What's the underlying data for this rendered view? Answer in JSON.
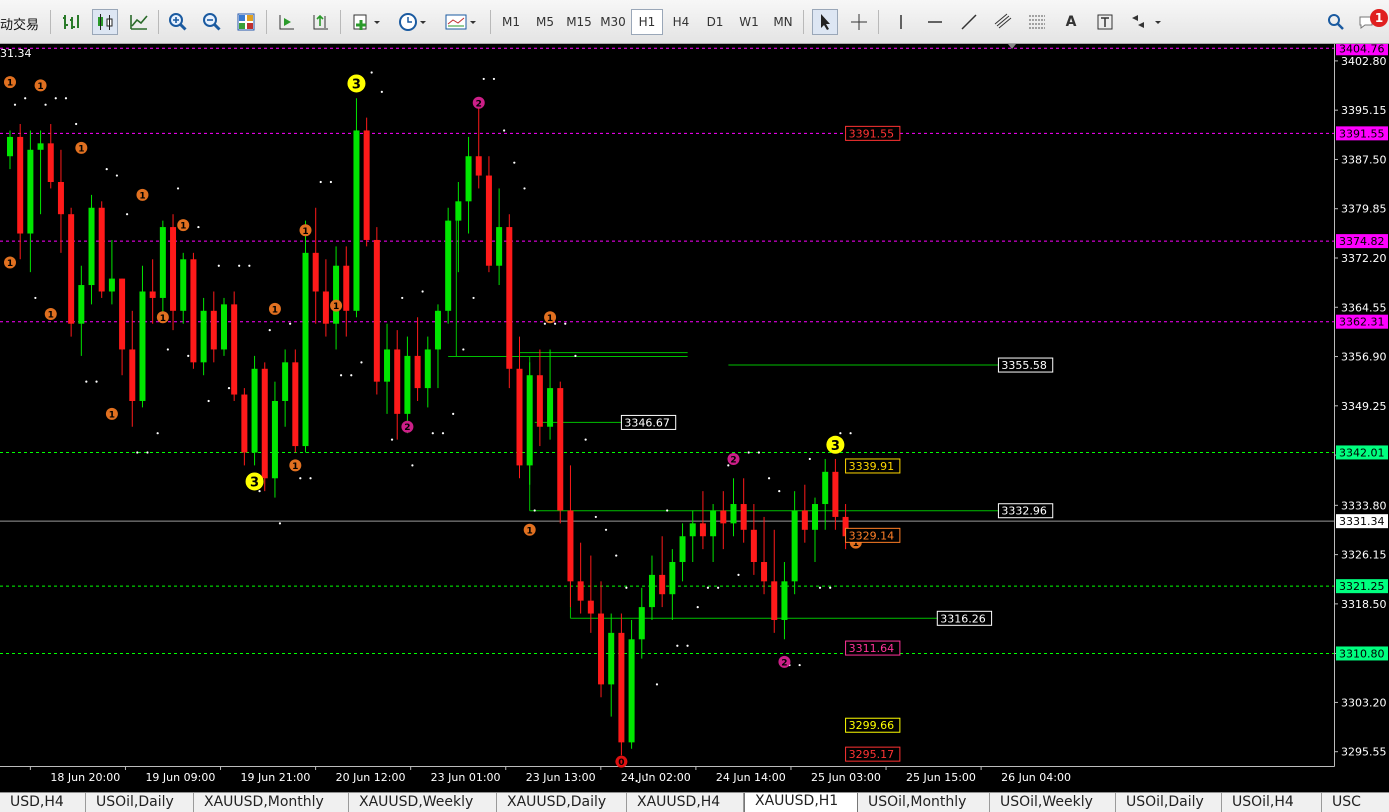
{
  "toolbar": {
    "app_title": "动交易",
    "timeframes": [
      "M1",
      "M5",
      "M15",
      "M30",
      "H1",
      "H4",
      "D1",
      "W1",
      "MN"
    ],
    "active_timeframe": "H1",
    "notification_count": "1"
  },
  "chart": {
    "symbol": "XAUUSD",
    "timeframe": "H1",
    "top_left_price": "31.34",
    "current_price": "3331.34",
    "price_axis": [
      "3402.80",
      "3395.15",
      "3387.50",
      "3379.85",
      "3372.20",
      "3364.55",
      "3356.90",
      "3349.25",
      "3341.60",
      "3333.80",
      "3326.15",
      "3318.50",
      "3310.80",
      "3303.20",
      "3295.55"
    ],
    "time_axis": [
      "18 Jun 20:00",
      "19 Jun 09:00",
      "19 Jun 21:00",
      "20 Jun 12:00",
      "23 Jun 01:00",
      "23 Jun 13:00",
      "24 Jun 02:00",
      "24 Jun 14:00",
      "25 Jun 03:00",
      "25 Jun 15:00",
      "26 Jun 04:00"
    ],
    "axis_labels": [
      {
        "text": "3404.76",
        "price": 3404.76,
        "bg": "#ff00ff",
        "fg": "#000000"
      },
      {
        "text": "3391.55",
        "price": 3391.55,
        "bg": "#ff00ff",
        "fg": "#000000"
      },
      {
        "text": "3374.82",
        "price": 3374.82,
        "bg": "#ff00ff",
        "fg": "#000000"
      },
      {
        "text": "3362.31",
        "price": 3362.31,
        "bg": "#ff00ff",
        "fg": "#000000"
      },
      {
        "text": "3342.01",
        "price": 3342.01,
        "bg": "#00ff7f",
        "fg": "#000000"
      },
      {
        "text": "3331.34",
        "price": 3331.34,
        "bg": "#ffffff",
        "fg": "#000000"
      },
      {
        "text": "3321.25",
        "price": 3321.25,
        "bg": "#00ff7f",
        "fg": "#000000"
      },
      {
        "text": "3310.80",
        "price": 3310.8,
        "bg": "#00ff7f",
        "fg": "#000000"
      }
    ],
    "level_lines": [
      {
        "price": 3404.76,
        "color": "#ff00ff"
      },
      {
        "price": 3391.55,
        "color": "#ff00ff"
      },
      {
        "price": 3374.82,
        "color": "#ff00ff"
      },
      {
        "price": 3362.31,
        "color": "#ff00ff"
      },
      {
        "price": 3342.01,
        "color": "#00ff00"
      },
      {
        "price": 3321.25,
        "color": "#00ff00"
      },
      {
        "price": 3310.8,
        "color": "#00ff00"
      }
    ],
    "inline_labels": [
      {
        "text": "3391.55",
        "price": 3391.55,
        "bar": 82,
        "color": "#ff3333",
        "border": "#ff3333",
        "bg": "#000000"
      },
      {
        "text": "3355.58",
        "price": 3355.58,
        "bar": 97,
        "color": "#ffffff",
        "border": "#ffffff",
        "bg": "#000000"
      },
      {
        "text": "3346.67",
        "price": 3346.67,
        "bar": 60,
        "color": "#ffffff",
        "border": "#ffffff",
        "bg": "#000000"
      },
      {
        "text": "3339.91",
        "price": 3339.91,
        "bar": 82,
        "color": "#ffd700",
        "border": "#ffd700",
        "bg": "#000000"
      },
      {
        "text": "3332.96",
        "price": 3332.96,
        "bar": 97,
        "color": "#ffffff",
        "border": "#ffffff",
        "bg": "#000000"
      },
      {
        "text": "3329.14",
        "price": 3329.14,
        "bar": 82,
        "color": "#ff7f27",
        "border": "#ff7f27",
        "bg": "#000000"
      },
      {
        "text": "3316.26",
        "price": 3316.26,
        "bar": 91,
        "color": "#ffffff",
        "border": "#ffffff",
        "bg": "#000000"
      },
      {
        "text": "3311.64",
        "price": 3311.64,
        "bar": 82,
        "color": "#ff3399",
        "border": "#ff3399",
        "bg": "#000000"
      },
      {
        "text": "3299.66",
        "price": 3299.66,
        "bar": 82,
        "color": "#ffff00",
        "border": "#ffff00",
        "bg": "#000000"
      },
      {
        "text": "3295.17",
        "price": 3295.17,
        "bar": 82,
        "color": "#ff3333",
        "border": "#ff3333",
        "bg": "#000000"
      }
    ],
    "markers": [
      {
        "t": "1",
        "bar": 0,
        "price": 3399.5,
        "c": "#e07020"
      },
      {
        "t": "1",
        "bar": 3,
        "price": 3399.0,
        "c": "#e07020"
      },
      {
        "t": "1",
        "bar": 0,
        "price": 3371.5,
        "c": "#e07020"
      },
      {
        "t": "1",
        "bar": 4,
        "price": 3363.5,
        "c": "#e07020"
      },
      {
        "t": "1",
        "bar": 7,
        "price": 3389.3,
        "c": "#e07020"
      },
      {
        "t": "1",
        "bar": 10,
        "price": 3348.0,
        "c": "#e07020"
      },
      {
        "t": "1",
        "bar": 13,
        "price": 3382.0,
        "c": "#e07020"
      },
      {
        "t": "1",
        "bar": 15,
        "price": 3363.0,
        "c": "#e07020"
      },
      {
        "t": "1",
        "bar": 17,
        "price": 3377.3,
        "c": "#e07020"
      },
      {
        "t": "3",
        "bar": 24,
        "price": 3337.5,
        "c": "#ffff00",
        "big": true
      },
      {
        "t": "1",
        "bar": 26,
        "price": 3364.3,
        "c": "#e07020"
      },
      {
        "t": "1",
        "bar": 29,
        "price": 3376.5,
        "c": "#e07020"
      },
      {
        "t": "1",
        "bar": 28,
        "price": 3340.0,
        "c": "#e07020"
      },
      {
        "t": "1",
        "bar": 32,
        "price": 3364.8,
        "c": "#e07020"
      },
      {
        "t": "3",
        "bar": 34,
        "price": 3399.3,
        "c": "#ffff00",
        "big": true
      },
      {
        "t": "2",
        "bar": 39,
        "price": 3346.0,
        "c": "#cc1f88"
      },
      {
        "t": "2",
        "bar": 46,
        "price": 3396.3,
        "c": "#cc1f88"
      },
      {
        "t": "1",
        "bar": 53,
        "price": 3363.0,
        "c": "#e07020"
      },
      {
        "t": "1",
        "bar": 51,
        "price": 3330.0,
        "c": "#e07020"
      },
      {
        "t": "2",
        "bar": 71,
        "price": 3341.0,
        "c": "#cc1f88"
      },
      {
        "t": "2",
        "bar": 76,
        "price": 3309.5,
        "c": "#cc1f88"
      },
      {
        "t": "3",
        "bar": 81,
        "price": 3343.2,
        "c": "#ffff00",
        "big": true
      },
      {
        "t": "1",
        "bar": 83,
        "price": 3328.0,
        "c": "#e07020"
      },
      {
        "t": "0",
        "bar": 60,
        "price": 3294.0,
        "c": "#e01010"
      }
    ],
    "hlines": [
      {
        "price": 3356.9,
        "bar_from": 43,
        "bar_to": 66.5,
        "color": "#00c000"
      },
      {
        "price": 3357.5,
        "bar_from": 50,
        "bar_to": 66.5,
        "color": "#00c000"
      },
      {
        "price": 3355.58,
        "bar_from": 70.5,
        "bar_to": 97,
        "color": "#00c000"
      },
      {
        "price": 3346.67,
        "bar_from": 51.5,
        "bar_to": 60,
        "color": "#00c000"
      },
      {
        "price": 3332.96,
        "bar_from": 51,
        "bar_to": 97,
        "color": "#00c000"
      },
      {
        "price": 3316.26,
        "bar_from": 55,
        "bar_to": 91,
        "color": "#00c000"
      }
    ],
    "vlines": [
      {
        "bar": 43.8,
        "price_from": 3356.9,
        "price_to": 3378.2,
        "color": "#00c000"
      },
      {
        "bar": 51,
        "price_from": 3332.96,
        "price_to": 3356.9,
        "color": "#00c000"
      },
      {
        "bar": 55,
        "price_from": 3316.26,
        "price_to": 3332.96,
        "color": "#00c000"
      }
    ],
    "candles": [
      [
        3388,
        3392,
        3386,
        3391
      ],
      [
        3391,
        3393,
        3372,
        3376
      ],
      [
        3376,
        3392,
        3370,
        3389
      ],
      [
        3389,
        3392,
        3379,
        3390
      ],
      [
        3390,
        3393,
        3383,
        3384
      ],
      [
        3384,
        3389,
        3373,
        3379
      ],
      [
        3379,
        3380,
        3360,
        3362
      ],
      [
        3362,
        3371,
        3357,
        3368
      ],
      [
        3368,
        3382,
        3365,
        3380
      ],
      [
        3380,
        3381,
        3366,
        3367
      ],
      [
        3367,
        3375,
        3365,
        3369
      ],
      [
        3369,
        3369,
        3354,
        3358
      ],
      [
        3358,
        3364,
        3346,
        3350
      ],
      [
        3350,
        3371,
        3349,
        3367
      ],
      [
        3367,
        3372,
        3362,
        3366
      ],
      [
        3366,
        3378,
        3363,
        3377
      ],
      [
        3377,
        3379,
        3361,
        3364
      ],
      [
        3364,
        3373,
        3362,
        3372
      ],
      [
        3372,
        3373,
        3355,
        3356
      ],
      [
        3356,
        3366,
        3354,
        3364
      ],
      [
        3364,
        3367,
        3356,
        3358
      ],
      [
        3358,
        3366,
        3357,
        3365
      ],
      [
        3365,
        3367,
        3350,
        3351
      ],
      [
        3351,
        3352,
        3340,
        3342
      ],
      [
        3342,
        3357,
        3340,
        3355
      ],
      [
        3355,
        3356,
        3336,
        3338
      ],
      [
        3338,
        3353,
        3335,
        3350
      ],
      [
        3350,
        3358,
        3346,
        3356
      ],
      [
        3356,
        3358,
        3342,
        3343
      ],
      [
        3343,
        3378,
        3342,
        3373
      ],
      [
        3373,
        3380,
        3362,
        3367
      ],
      [
        3367,
        3372,
        3360,
        3362
      ],
      [
        3362,
        3374,
        3358,
        3371
      ],
      [
        3371,
        3374,
        3360,
        3364
      ],
      [
        3364,
        3397,
        3363,
        3392
      ],
      [
        3392,
        3394,
        3374,
        3375
      ],
      [
        3375,
        3377,
        3351,
        3353
      ],
      [
        3353,
        3362,
        3348,
        3358
      ],
      [
        3358,
        3361,
        3344,
        3348
      ],
      [
        3348,
        3360,
        3345,
        3357
      ],
      [
        3357,
        3363,
        3350,
        3352
      ],
      [
        3352,
        3360,
        3349,
        3358
      ],
      [
        3358,
        3365,
        3352,
        3364
      ],
      [
        3364,
        3380,
        3362,
        3378
      ],
      [
        3378,
        3384,
        3370,
        3381
      ],
      [
        3381,
        3391,
        3376,
        3388
      ],
      [
        3388,
        3396,
        3383,
        3385
      ],
      [
        3385,
        3388,
        3370,
        3371
      ],
      [
        3371,
        3383,
        3368,
        3377
      ],
      [
        3377,
        3379,
        3352,
        3355
      ],
      [
        3355,
        3360,
        3338,
        3340
      ],
      [
        3340,
        3356,
        3337,
        3354
      ],
      [
        3354,
        3358,
        3343,
        3346
      ],
      [
        3346,
        3358,
        3344,
        3352
      ],
      [
        3352,
        3353,
        3331,
        3333
      ],
      [
        3333,
        3340,
        3318,
        3322
      ],
      [
        3322,
        3328,
        3317,
        3319
      ],
      [
        3319,
        3326,
        3314,
        3317
      ],
      [
        3317,
        3322,
        3304,
        3306
      ],
      [
        3306,
        3317,
        3301,
        3314
      ],
      [
        3314,
        3317,
        3295,
        3297
      ],
      [
        3297,
        3316,
        3296,
        3313
      ],
      [
        3313,
        3321,
        3310,
        3318
      ],
      [
        3318,
        3326,
        3316,
        3323
      ],
      [
        3323,
        3329,
        3318,
        3320
      ],
      [
        3320,
        3327,
        3316,
        3325
      ],
      [
        3325,
        3331,
        3322,
        3329
      ],
      [
        3329,
        3333,
        3325,
        3331
      ],
      [
        3331,
        3336,
        3327,
        3329
      ],
      [
        3329,
        3334,
        3325,
        3333
      ],
      [
        3333,
        3336,
        3327,
        3331
      ],
      [
        3331,
        3338,
        3329,
        3334
      ],
      [
        3334,
        3338,
        3328,
        3330
      ],
      [
        3330,
        3334,
        3323,
        3325
      ],
      [
        3325,
        3332,
        3320,
        3322
      ],
      [
        3322,
        3330,
        3314,
        3316
      ],
      [
        3316,
        3325,
        3313,
        3322
      ],
      [
        3322,
        3336,
        3320,
        3333
      ],
      [
        3333,
        3337,
        3328,
        3330
      ],
      [
        3330,
        3335,
        3325,
        3334
      ],
      [
        3334,
        3341,
        3330,
        3339
      ],
      [
        3339,
        3341,
        3330,
        3332
      ],
      [
        3332,
        3334,
        3327,
        3329
      ]
    ]
  },
  "tabs": [
    {
      "label": "USD,H4"
    },
    {
      "label": "USOil,Daily"
    },
    {
      "label": "XAUUSD,Monthly"
    },
    {
      "label": "XAUUSD,Weekly"
    },
    {
      "label": "XAUUSD,Daily"
    },
    {
      "label": "XAUUSD,H4"
    },
    {
      "label": "XAUUSD,H1",
      "active": true
    },
    {
      "label": "USOil,Monthly"
    },
    {
      "label": "USOil,Weekly"
    },
    {
      "label": "USOil,Daily"
    },
    {
      "label": "USOil,H4"
    },
    {
      "label": "USC"
    }
  ]
}
